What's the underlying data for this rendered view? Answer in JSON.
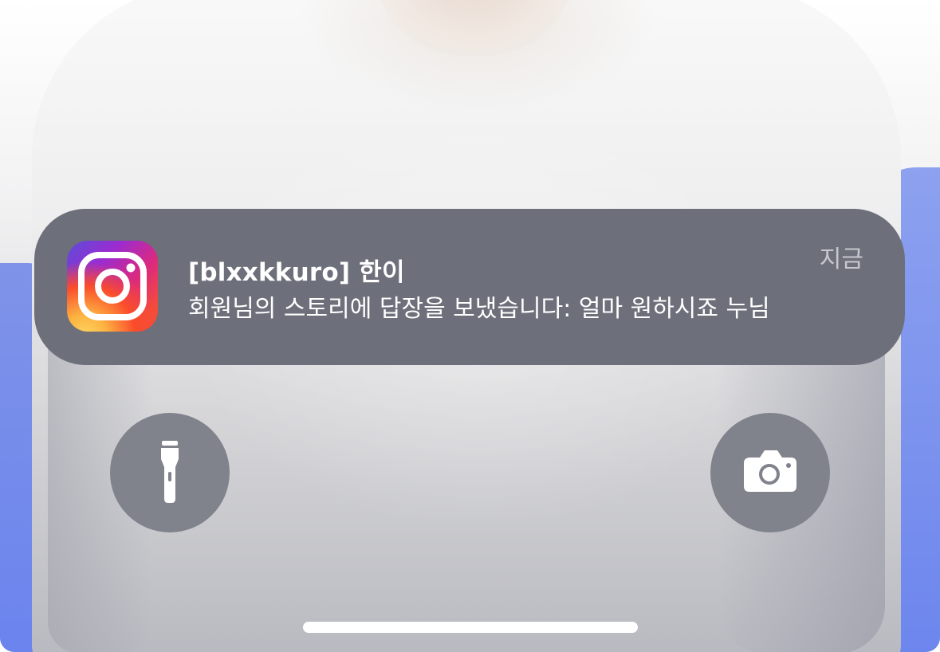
{
  "notification": {
    "app_icon": "instagram-icon",
    "title": "[blxxkkuro] 한이",
    "body": "회원님의 스토리에 답장을 보냈습니다: 얼마 원하시죠 누님",
    "time": "지금"
  },
  "quick_actions": {
    "left_icon": "flashlight-icon",
    "right_icon": "camera-icon"
  },
  "colors": {
    "notification_bg": "#6d6f7a",
    "button_bg": "#80828c",
    "home_indicator": "#ffffff"
  }
}
